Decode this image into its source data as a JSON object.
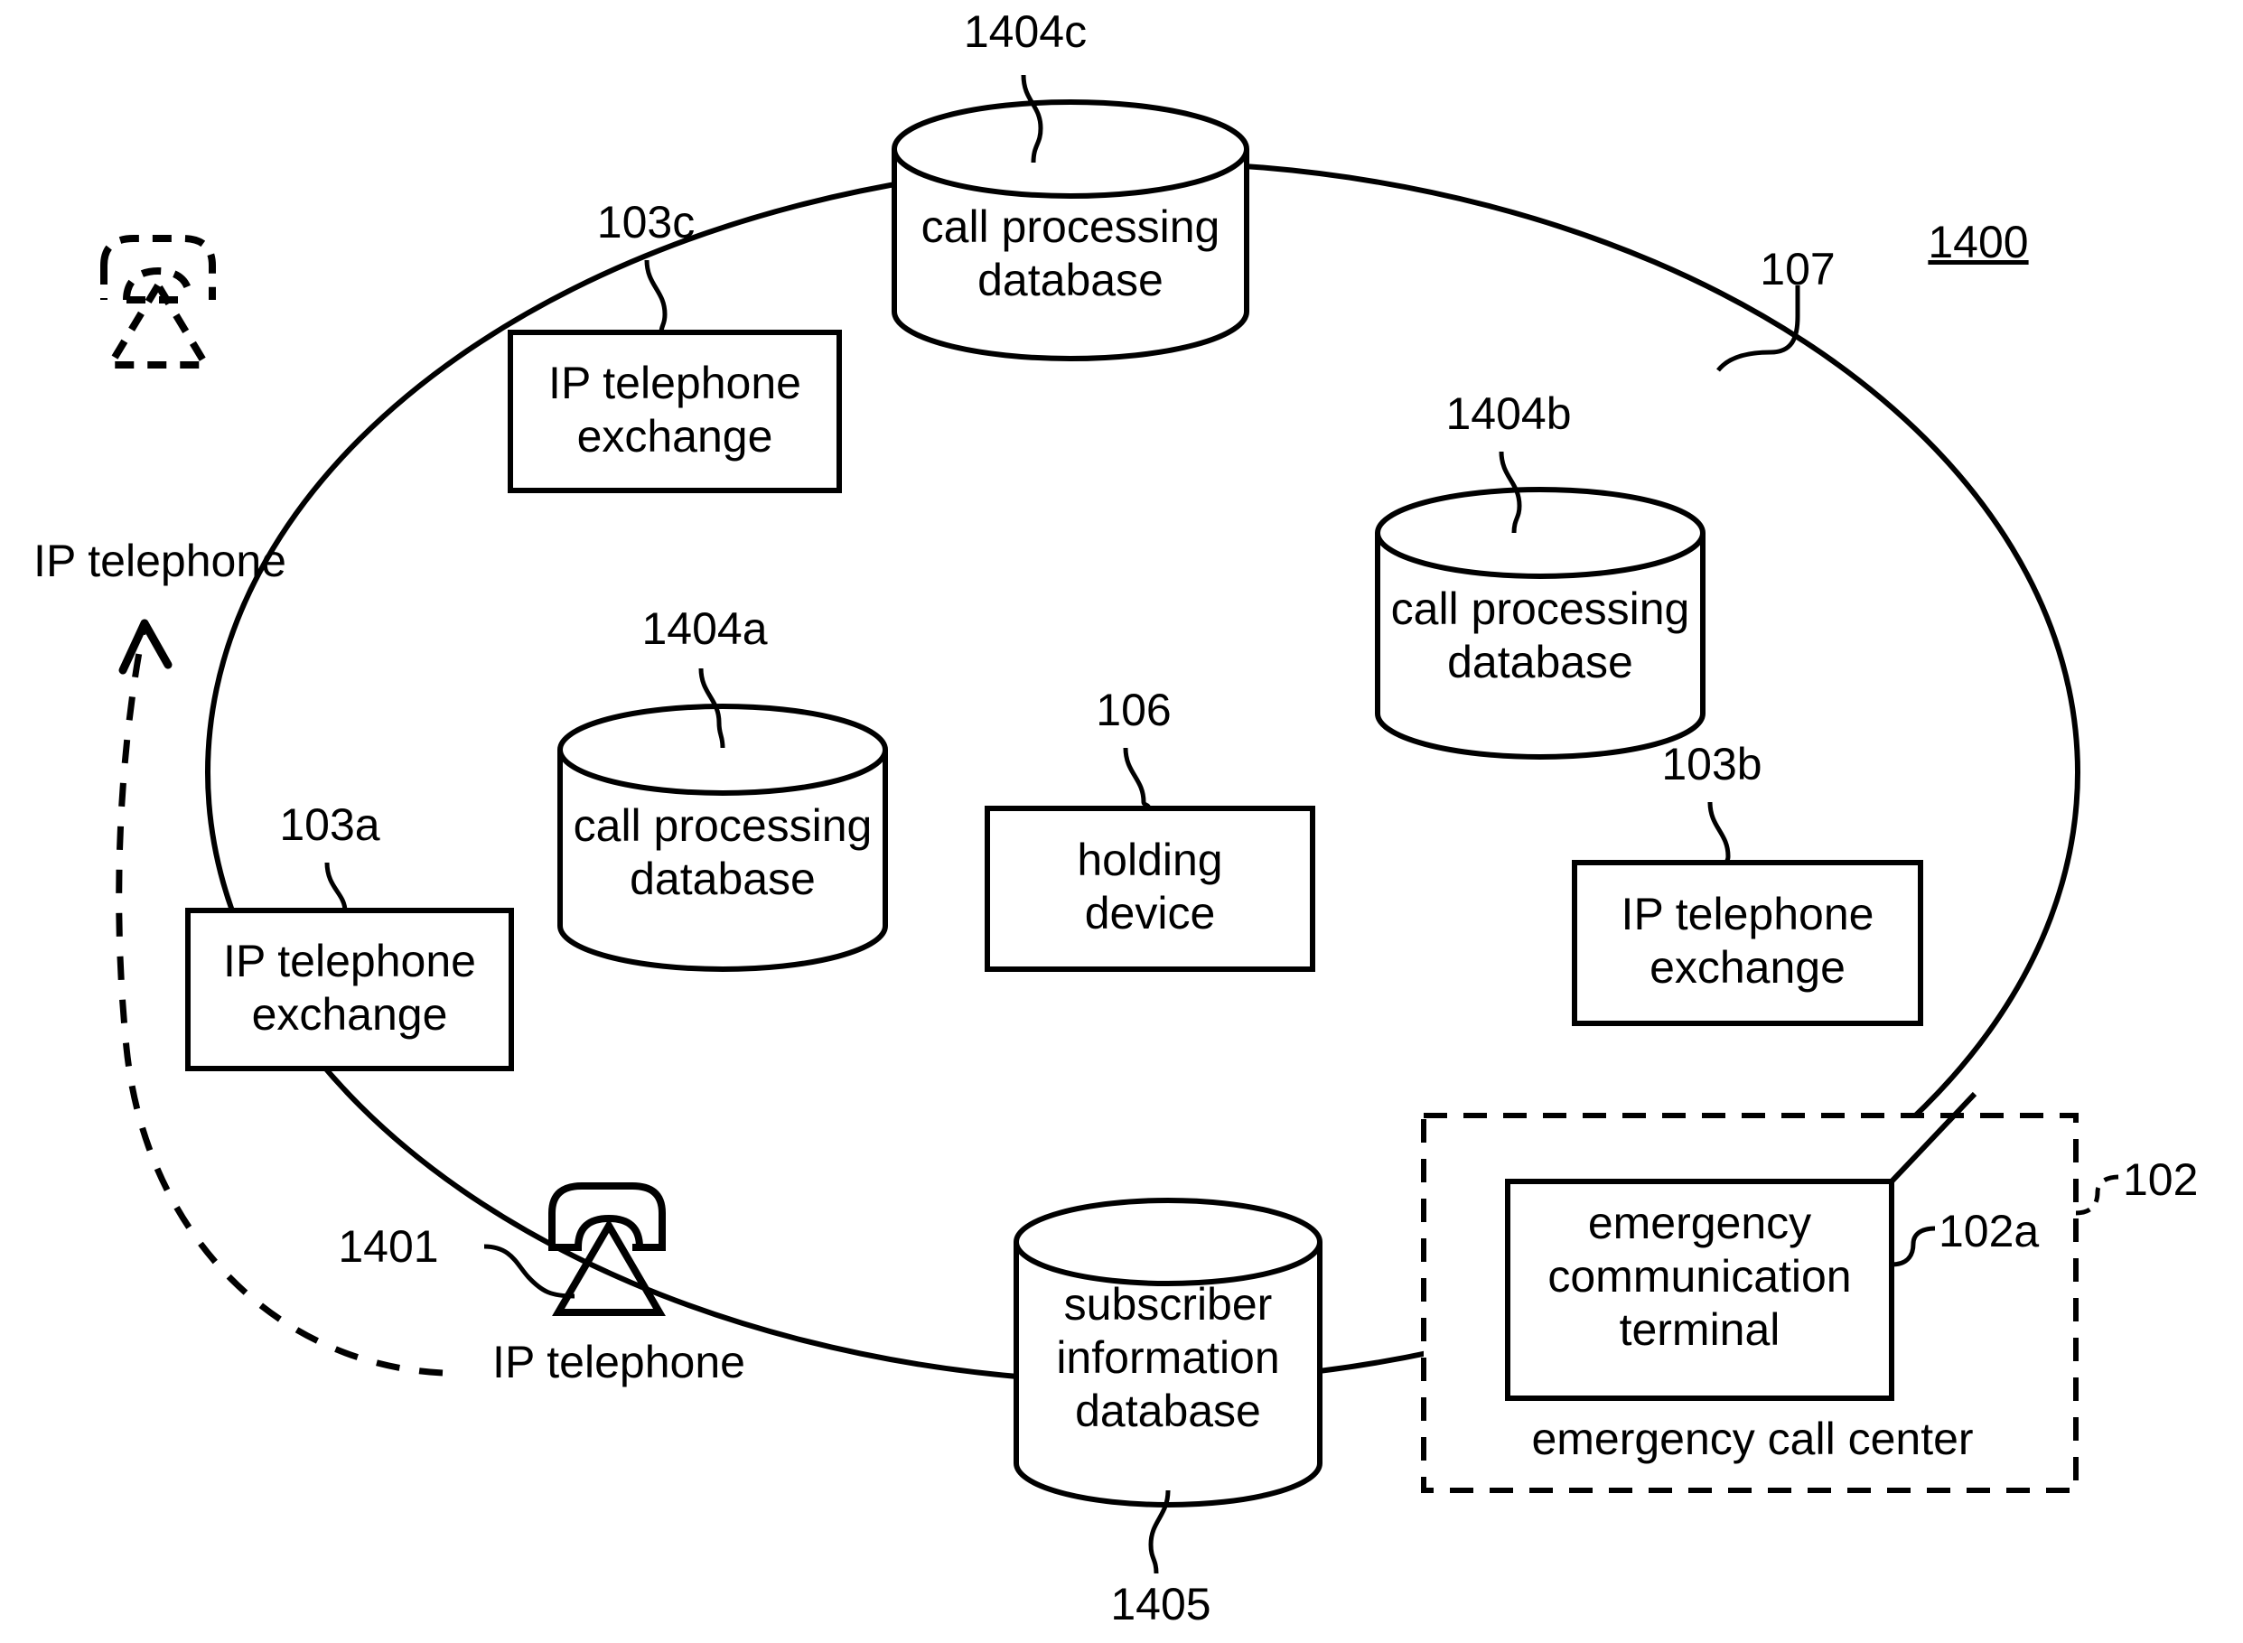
{
  "figure": {
    "number_label": "1400",
    "network_ref": "107",
    "type": "patent-network-diagram"
  },
  "nodes": {
    "ip_telephone_left": {
      "caption": "IP telephone",
      "style": "dashed"
    },
    "ip_telephone_bottom": {
      "caption": "IP telephone",
      "ref": "1401",
      "style": "solid"
    },
    "exchange_c": {
      "line1": "IP telephone",
      "line2": "exchange",
      "ref": "103c"
    },
    "exchange_a": {
      "line1": "IP telephone",
      "line2": "exchange",
      "ref": "103a"
    },
    "exchange_b": {
      "line1": "IP telephone",
      "line2": "exchange",
      "ref": "103b"
    },
    "db_c": {
      "line1": "call processing",
      "line2": "database",
      "ref": "1404c"
    },
    "db_b": {
      "line1": "call processing",
      "line2": "database",
      "ref": "1404b"
    },
    "db_a": {
      "line1": "call processing",
      "line2": "database",
      "ref": "1404a"
    },
    "holding_device": {
      "line1": "holding",
      "line2": "device",
      "ref": "106"
    },
    "subscriber_db": {
      "line1": "subscriber",
      "line2": "information",
      "line3": "database",
      "ref": "1405"
    },
    "emergency_terminal": {
      "line1": "emergency",
      "line2": "communication",
      "line3": "terminal",
      "ref": "102a"
    },
    "emergency_call_center": {
      "caption": "emergency call center",
      "ref": "102",
      "style": "dashed"
    }
  },
  "colors": {
    "stroke": "#000000",
    "fill": "#ffffff"
  }
}
